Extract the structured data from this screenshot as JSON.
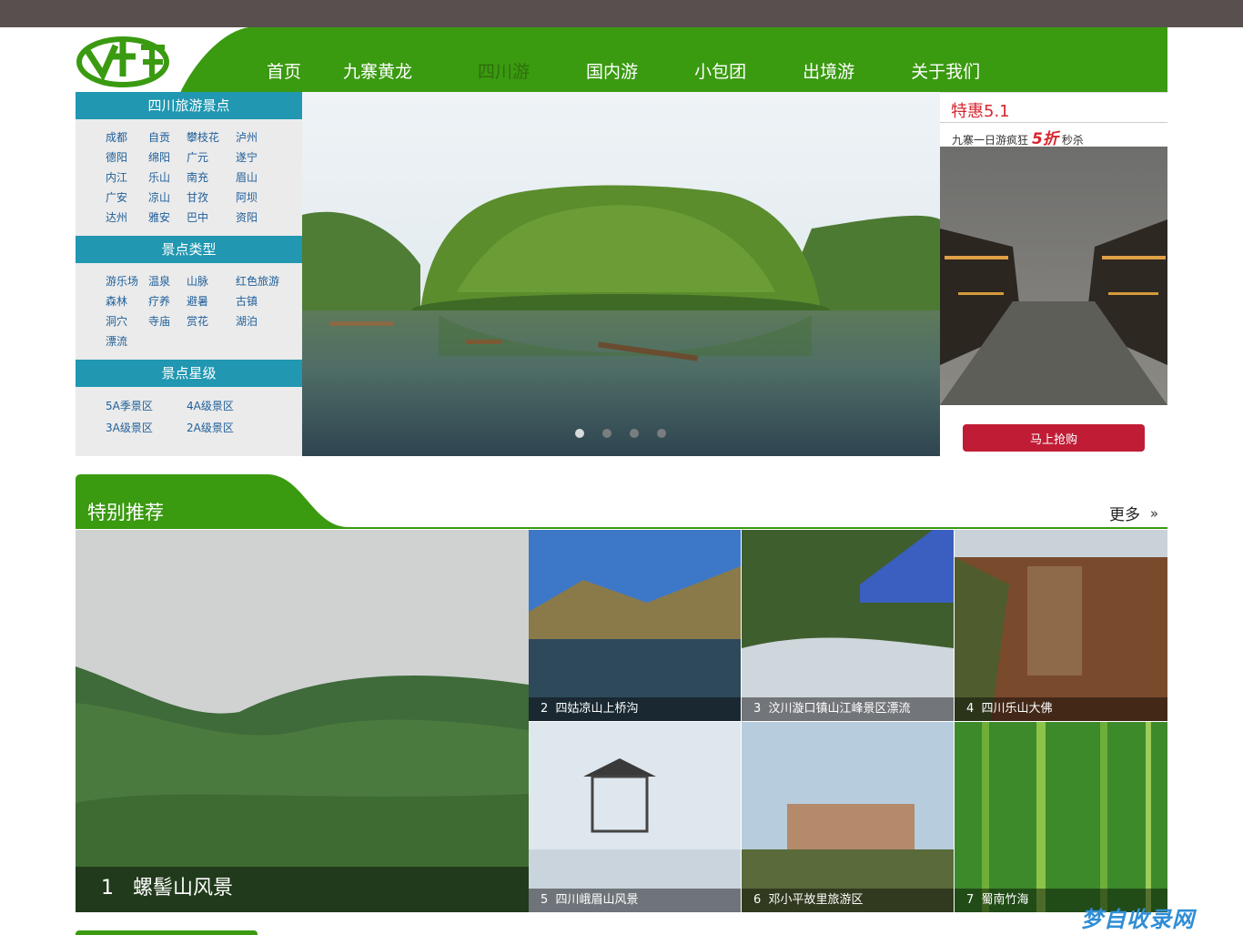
{
  "nav": {
    "items": [
      "首页",
      "九寨黄龙",
      "四川游",
      "国内游",
      "小包团",
      "出境游",
      "关于我们"
    ],
    "active": "四川游"
  },
  "sidebar": {
    "section1_title": "四川旅游景点",
    "cities": [
      "成都",
      "自贡",
      "攀枝花",
      "泸州",
      "德阳",
      "绵阳",
      "广元",
      "遂宁",
      "内江",
      "乐山",
      "南充",
      "眉山",
      "广安",
      "凉山",
      "甘孜",
      "阿坝",
      "达州",
      "雅安",
      "巴中",
      "资阳"
    ],
    "section2_title": "景点类型",
    "types": [
      "游乐场",
      "温泉",
      "山脉",
      "红色旅游",
      "森林",
      "疗养",
      "避暑",
      "古镇",
      "洞穴",
      "寺庙",
      "赏花",
      "湖泊",
      "漂流"
    ],
    "section3_title": "景点星级",
    "levels": [
      "5A季景区",
      "4A级景区",
      "3A级景区",
      "2A级景区"
    ]
  },
  "promo": {
    "title": "特惠5.1",
    "subtitle_pre": "九寨一日游疯狂",
    "discount": "5折",
    "subtitle_post": "秒杀",
    "button": "马上抢购"
  },
  "special": {
    "title": "特别推荐",
    "more": "更多",
    "tiles": [
      {
        "num": "1",
        "name": "螺髻山风景"
      },
      {
        "num": "2",
        "name": "四姑凉山上桥沟"
      },
      {
        "num": "3",
        "name": "汶川漩口镇山江峰景区漂流"
      },
      {
        "num": "4",
        "name": "四川乐山大佛"
      },
      {
        "num": "5",
        "name": "四川峨眉山风景"
      },
      {
        "num": "6",
        "name": "邓小平故里旅游区"
      },
      {
        "num": "7",
        "name": "蜀南竹海"
      }
    ]
  },
  "watermark": "梦自收录网",
  "colors": {
    "green": "#3a9a10",
    "teal": "#2197b1",
    "red": "#c11c36",
    "topbar": "#5a4f4f"
  }
}
